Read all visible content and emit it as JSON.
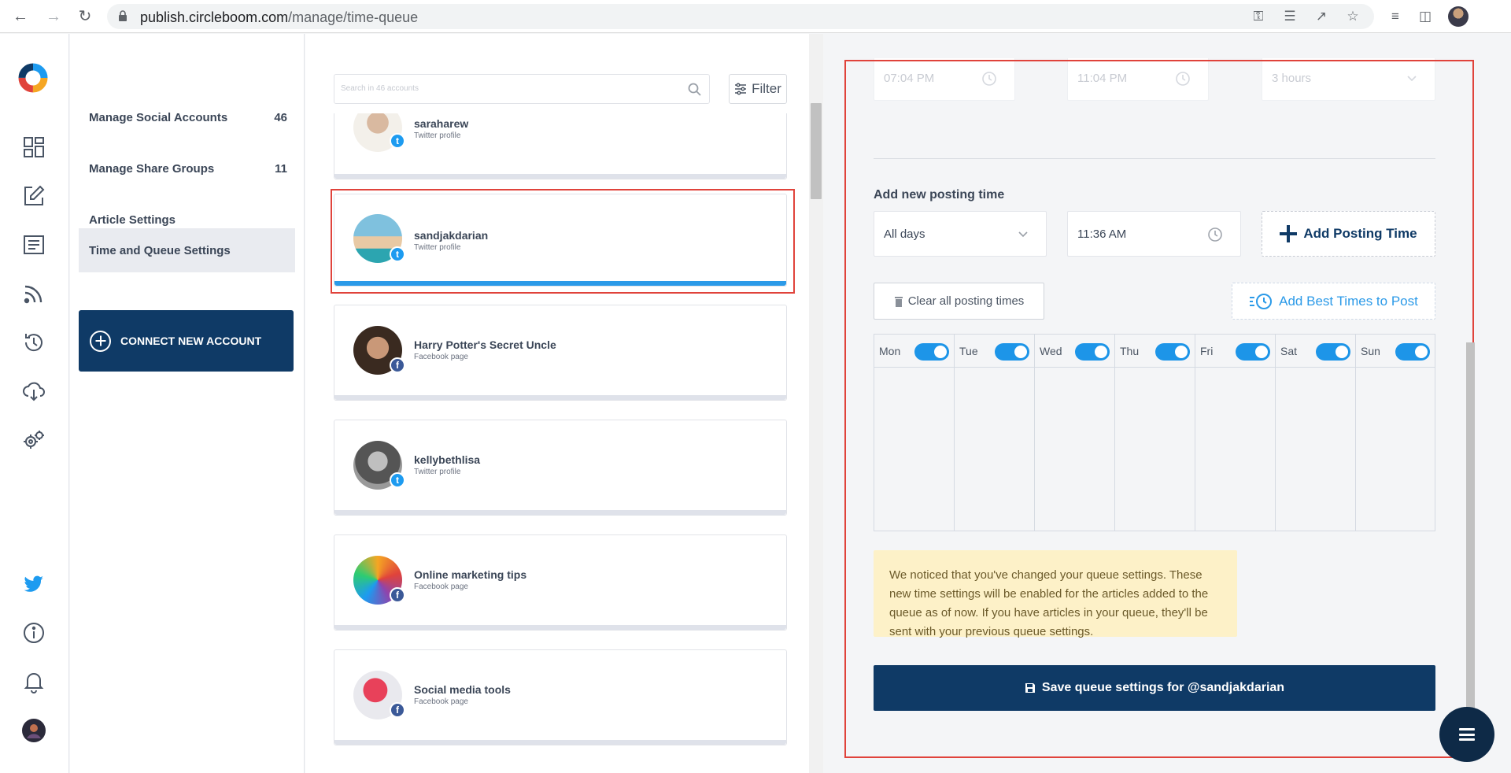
{
  "browser": {
    "url_domain": "publish.circleboom.com",
    "url_path": "/manage/time-queue"
  },
  "menu": {
    "items": [
      {
        "label": "Manage Social Accounts",
        "count": "46"
      },
      {
        "label": "Manage Share Groups",
        "count": "11"
      },
      {
        "label": "Article Settings",
        "count": ""
      },
      {
        "label": "Time and Queue Settings",
        "count": ""
      }
    ],
    "connect_label": "CONNECT NEW ACCOUNT"
  },
  "accounts": {
    "search_placeholder": "Search in 46 accounts",
    "filter_label": "Filter",
    "list": [
      {
        "name": "saraharew",
        "type": "Twitter profile",
        "network": "twitter"
      },
      {
        "name": "sandjakdarian",
        "type": "Twitter profile",
        "network": "twitter"
      },
      {
        "name": "Harry Potter's Secret Uncle",
        "type": "Facebook page",
        "network": "facebook"
      },
      {
        "name": "kellybethlisa",
        "type": "Twitter profile",
        "network": "twitter"
      },
      {
        "name": "Online marketing tips",
        "type": "Facebook page",
        "network": "facebook"
      },
      {
        "name": "Social media tools",
        "type": "Facebook page",
        "network": "facebook"
      }
    ]
  },
  "panel": {
    "prev_start": "07:04 PM",
    "prev_end": "11:04 PM",
    "prev_interval": "3 hours",
    "add_section_label": "Add new posting time",
    "day_select": "All days",
    "time_value": "11:36 AM",
    "add_button": "Add Posting Time",
    "clear_button": "Clear all posting times",
    "best_button": "Add Best Times to Post",
    "days": [
      "Mon",
      "Tue",
      "Wed",
      "Thu",
      "Fri",
      "Sat",
      "Sun"
    ],
    "notice": "We noticed that you've changed your queue settings. These new time settings will be enabled for the articles added to the queue as of now. If you have articles in your queue, they'll be sent with your previous queue settings.",
    "save_button": "Save queue settings for @sandjakdarian"
  },
  "colors": {
    "primary": "#0f3a66",
    "accent": "#1d95e8",
    "highlight": "#e0433b",
    "notice_bg": "#fdf1c8"
  }
}
